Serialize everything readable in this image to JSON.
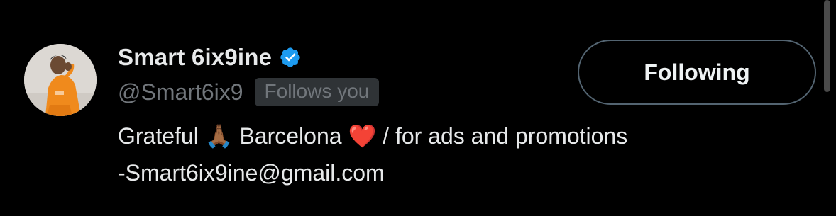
{
  "user": {
    "display_name": "Smart 6ix9ine",
    "verified_icon": "verified-badge-icon",
    "handle": "@Smart6ix9",
    "follows_you_label": "Follows you",
    "avatar_icon": "profile-photo"
  },
  "follow_button": {
    "label": "Following"
  },
  "bio": {
    "part1": "Grateful ",
    "emoji1": "🙏🏾",
    "part2": " Barcelona ",
    "emoji2": "❤️",
    "part3": " / for ads and promotions",
    "line2": "-Smart6ix9ine@gmail.com"
  },
  "colors": {
    "background": "#000000",
    "primary_text": "#e7e9ea",
    "secondary_text": "#71767b",
    "verified_blue": "#1d9bf0",
    "badge_background": "#2f3336",
    "button_border": "#536471"
  }
}
